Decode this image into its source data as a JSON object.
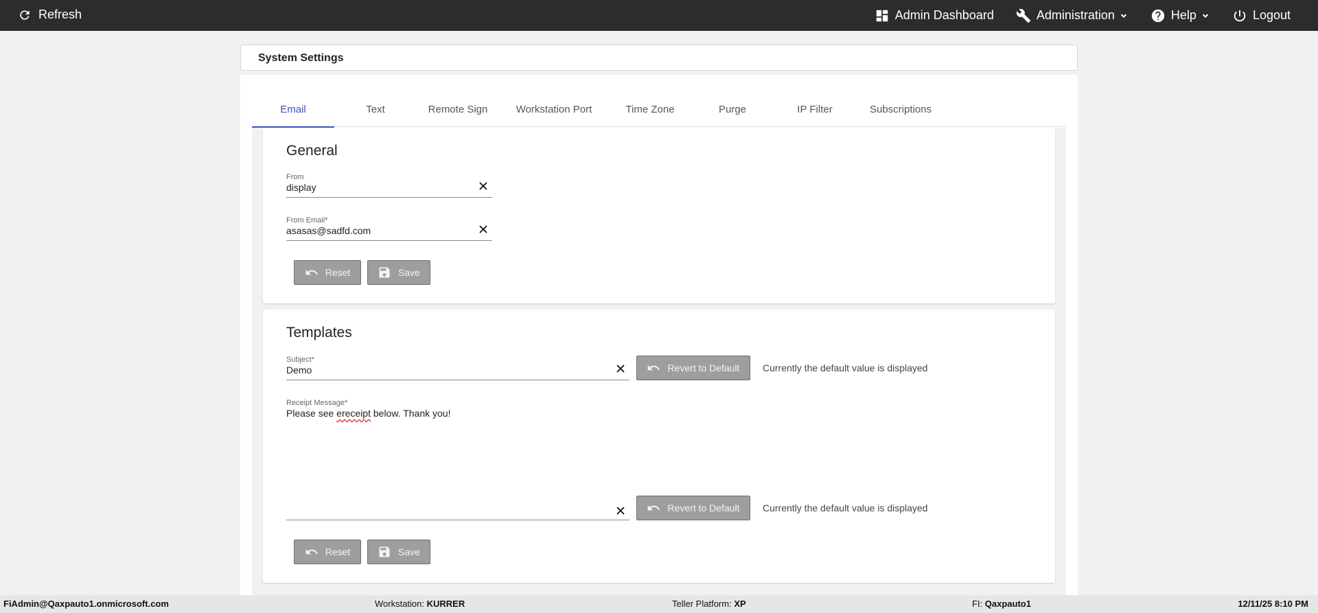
{
  "topbar": {
    "refresh_label": "Refresh",
    "admin_dashboard_label": "Admin Dashboard",
    "administration_label": "Administration",
    "help_label": "Help",
    "logout_label": "Logout"
  },
  "page": {
    "title": "System Settings"
  },
  "tabs": [
    {
      "label": "Email"
    },
    {
      "label": "Text"
    },
    {
      "label": "Remote Sign"
    },
    {
      "label": "Workstation Port"
    },
    {
      "label": "Time Zone"
    },
    {
      "label": "Purge"
    },
    {
      "label": "IP Filter"
    },
    {
      "label": "Subscriptions"
    }
  ],
  "general": {
    "heading": "General",
    "from": {
      "label": "From",
      "value": "display"
    },
    "from_email": {
      "label": "From Email*",
      "value": "asasas@sadfd.com"
    },
    "reset_label": "Reset",
    "save_label": "Save"
  },
  "templates": {
    "heading": "Templates",
    "subject": {
      "label": "Subject*",
      "value": "Demo"
    },
    "receipt": {
      "label": "Receipt Message*",
      "value_before": "Please see ",
      "value_misspelled": "ereceipt",
      "value_after": " below. Thank you!"
    },
    "revert_label": "Revert to Default",
    "default_hint": "Currently the default value is displayed",
    "reset_label": "Reset",
    "save_label": "Save"
  },
  "footer": {
    "user": "FiAdmin@Qaxpauto1.onmicrosoft.com",
    "workstation_label": "Workstation: ",
    "workstation_value": "KURRER",
    "teller_label": "Teller Platform: ",
    "teller_value": "XP",
    "fi_label": "FI: ",
    "fi_value": "Qaxpauto1",
    "datetime": "12/11/25 8:10 PM"
  },
  "colors": {
    "accent": "#3f51b5",
    "topbar": "#2c2c2c",
    "button": "#9e9e9e"
  }
}
